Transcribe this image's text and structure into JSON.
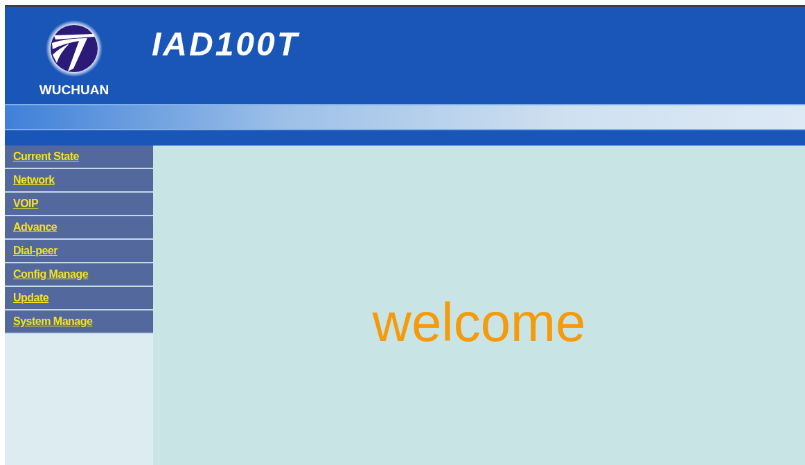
{
  "header": {
    "brand": "WUCHUAN",
    "product": "IAD100T"
  },
  "menu": [
    {
      "label": "Current State"
    },
    {
      "label": "Network"
    },
    {
      "label": "VOIP"
    },
    {
      "label": "Advance"
    },
    {
      "label": "Dial-peer"
    },
    {
      "label": "Config Manage"
    },
    {
      "label": "Update"
    },
    {
      "label": "System Manage"
    }
  ],
  "content": {
    "greeting": "welcome"
  }
}
